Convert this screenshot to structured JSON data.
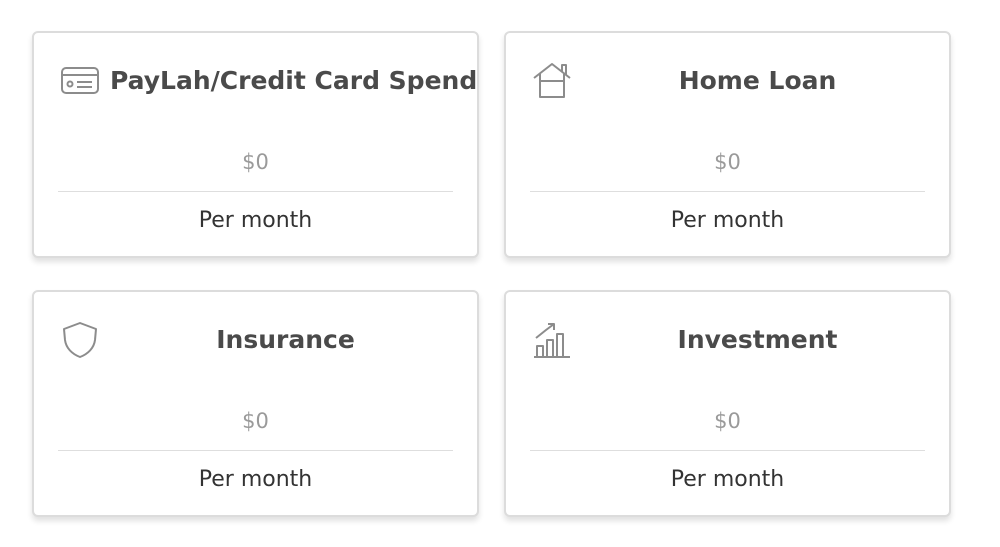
{
  "cards": [
    {
      "title": "PayLah/Credit Card Spend",
      "amount": "$0",
      "period": "Per month",
      "icon": "credit-card-icon"
    },
    {
      "title": "Home Loan",
      "amount": "$0",
      "period": "Per month",
      "icon": "house-icon"
    },
    {
      "title": "Insurance",
      "amount": "$0",
      "period": "Per month",
      "icon": "shield-icon"
    },
    {
      "title": "Investment",
      "amount": "$0",
      "period": "Per month",
      "icon": "bar-chart-growth-icon"
    }
  ],
  "colors": {
    "card_border": "#dcdcdc",
    "title_text": "#4a4a4a",
    "amount_text": "#9a9a9a",
    "icon": "#8c8c8c"
  }
}
